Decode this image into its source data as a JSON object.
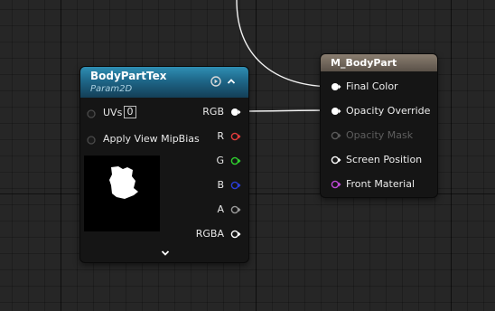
{
  "texture_node": {
    "title": "BodyPartTex",
    "subtitle": "Param2D",
    "uvs_label": "UVs",
    "uvs_value": "0",
    "mip_label": "Apply View MipBias",
    "outputs": [
      "RGB",
      "R",
      "G",
      "B",
      "A",
      "RGBA"
    ],
    "output_colors": [
      "#ffffff",
      "#e33b3b",
      "#2fd12f",
      "#2a3ed8",
      "#9a9a9a",
      "#ffffff"
    ],
    "header_color": "#1e6688",
    "icons": [
      "play-circle-icon",
      "chevron-up-icon",
      "chevron-down-icon"
    ]
  },
  "material_node": {
    "title": "M_BodyPart",
    "inputs": [
      "Final Color",
      "Opacity Override",
      "Opacity Mask",
      "Screen Position",
      "Front Material"
    ],
    "input_colors": [
      "#ffffff",
      "#ffffff",
      "#5a5a5a",
      "#ffffff",
      "#c04ad8"
    ],
    "header_color": "#6e6459"
  }
}
